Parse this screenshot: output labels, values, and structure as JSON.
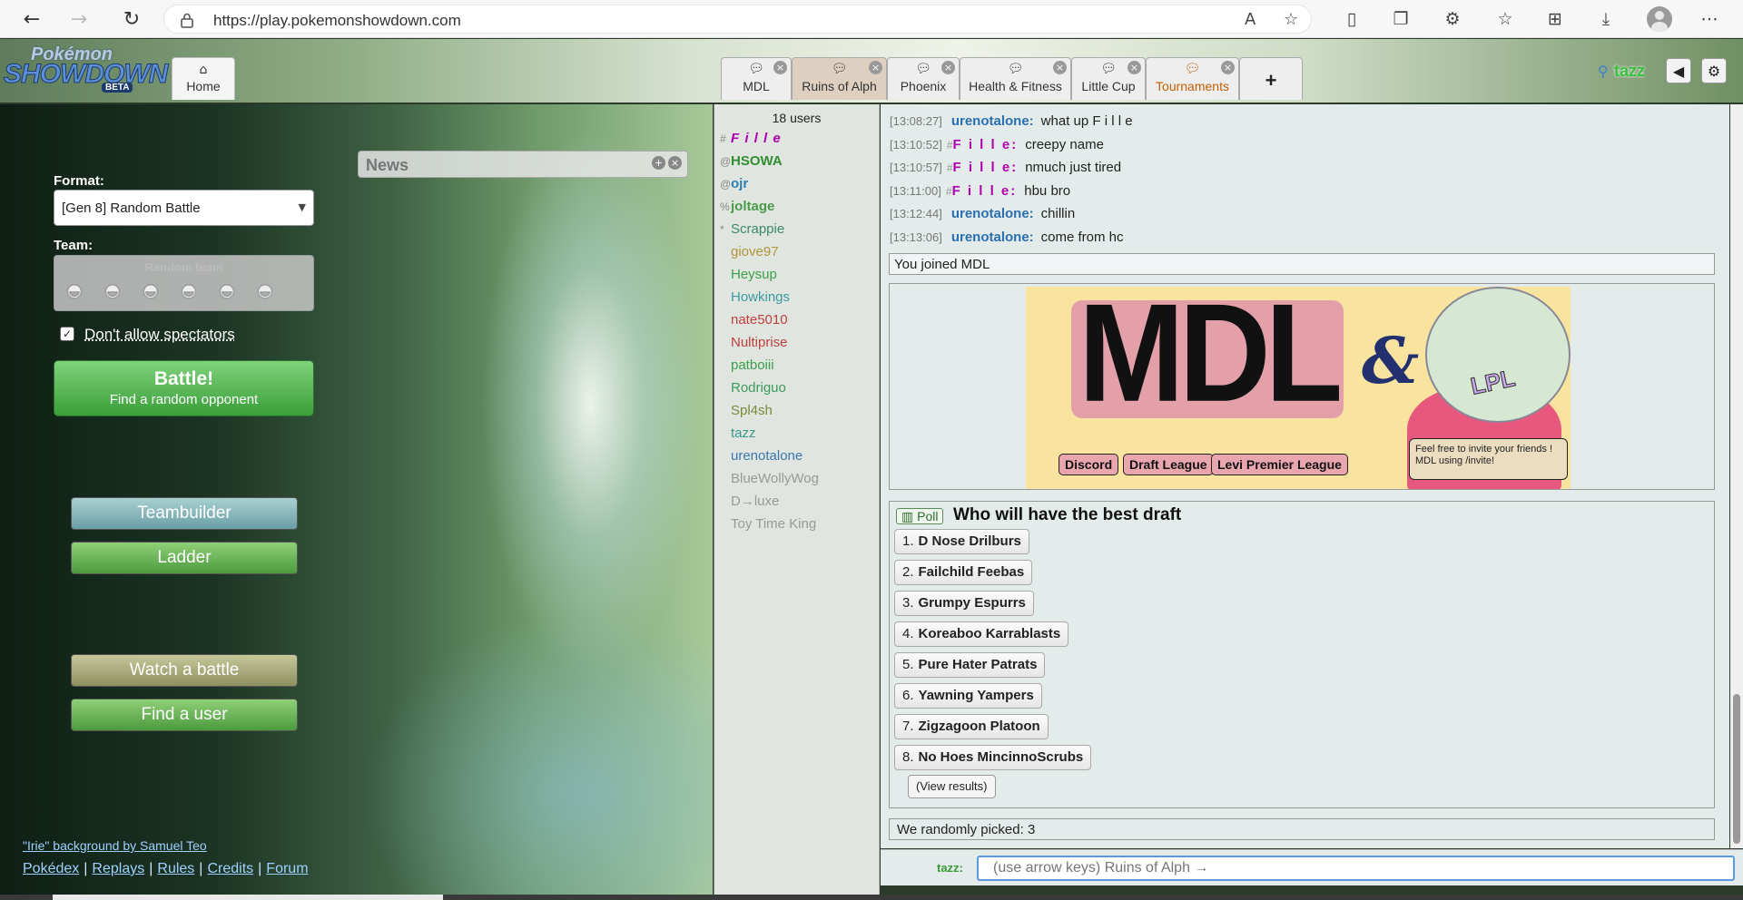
{
  "browser": {
    "url": "https://play.pokemonshowdown.com"
  },
  "header": {
    "logo_line1": "Pokémon",
    "logo_line2": "SHOWDOWN",
    "logo_badge": "BETA",
    "home_label": "Home",
    "tabs": [
      {
        "label": "MDL",
        "active": false
      },
      {
        "label": "Ruins of Alph",
        "active": true
      },
      {
        "label": "Phoenix",
        "active": false
      },
      {
        "label": "Health & Fitness",
        "active": false
      },
      {
        "label": "Little Cup",
        "active": false
      },
      {
        "label": "Tournaments",
        "active": false,
        "highlight": true
      }
    ],
    "add_tab": "+",
    "username": "tazz"
  },
  "left": {
    "news_title": "News",
    "format_label": "Format:",
    "format_value": "[Gen 8] Random Battle",
    "team_label": "Team:",
    "team_value": "Random team",
    "spectators_label": "Don't allow spectators",
    "spectators_checked": true,
    "battle_title": "Battle!",
    "battle_sub": "Find a random opponent",
    "teambuilder": "Teambuilder",
    "ladder": "Ladder",
    "watch": "Watch a battle",
    "find_user": "Find a user",
    "bg_credit": "\"Irie\" background by Samuel Teo",
    "footer": [
      "Pokédex",
      "Replays",
      "Rules",
      "Credits",
      "Forum"
    ]
  },
  "userlist": {
    "count": "18 users",
    "users": [
      {
        "rank": "#",
        "name": "F i l l e",
        "color": "#b000b0",
        "style": "bold-italic"
      },
      {
        "rank": "@",
        "name": "HSOWA",
        "color": "#2f8f2f",
        "style": "bold"
      },
      {
        "rank": "@",
        "name": "ojr",
        "color": "#2a7fb0",
        "style": "bold"
      },
      {
        "rank": "%",
        "name": "joltage",
        "color": "#4a9a4a",
        "style": "bold"
      },
      {
        "rank": "*",
        "name": "Scrappie",
        "color": "#3a8a6a",
        "style": "normal"
      },
      {
        "rank": "",
        "name": "giove97",
        "color": "#b0963a",
        "style": "normal"
      },
      {
        "rank": "",
        "name": "Heysup",
        "color": "#3aa04a",
        "style": "normal"
      },
      {
        "rank": "",
        "name": "Howkings",
        "color": "#3a9aa0",
        "style": "normal"
      },
      {
        "rank": "",
        "name": "nate5010",
        "color": "#c04040",
        "style": "normal"
      },
      {
        "rank": "",
        "name": "Nultiprise",
        "color": "#c04040",
        "style": "normal"
      },
      {
        "rank": "",
        "name": "patboiii",
        "color": "#3aa04a",
        "style": "normal"
      },
      {
        "rank": "",
        "name": "Rodriguo",
        "color": "#3a9a5a",
        "style": "normal"
      },
      {
        "rank": "",
        "name": "Spl4sh",
        "color": "#7a8a3a",
        "style": "normal"
      },
      {
        "rank": "",
        "name": "tazz",
        "color": "#3a9a8a",
        "style": "normal"
      },
      {
        "rank": "",
        "name": "urenotalone",
        "color": "#3a7ab0",
        "style": "normal"
      },
      {
        "rank": "",
        "name": "BlueWollyWog",
        "color": "#999999",
        "style": "idle"
      },
      {
        "rank": "",
        "name": "D→luxe",
        "color": "#999999",
        "style": "idle"
      },
      {
        "rank": "",
        "name": "Toy Time King",
        "color": "#999999",
        "style": "idle"
      }
    ]
  },
  "chat": {
    "messages": [
      {
        "ts": "[13:08:27]",
        "rank": "",
        "author": "urenotalone:",
        "color": "#2a6fb0",
        "text": "what up F i l l e"
      },
      {
        "ts": "[13:10:52]",
        "rank": "#",
        "author": "F i l l e:",
        "color": "#b000b0",
        "text": "creepy name"
      },
      {
        "ts": "[13:10:57]",
        "rank": "#",
        "author": "F i l l e:",
        "color": "#b000b0",
        "text": "nmuch just tired"
      },
      {
        "ts": "[13:11:00]",
        "rank": "#",
        "author": "F i l l e:",
        "color": "#b000b0",
        "text": "hbu bro"
      },
      {
        "ts": "[13:12:44]",
        "rank": "",
        "author": "urenotalone:",
        "color": "#2a6fb0",
        "text": "chillin"
      },
      {
        "ts": "[13:13:06]",
        "rank": "",
        "author": "urenotalone:",
        "color": "#2a6fb0",
        "text": "come from hc"
      }
    ],
    "joined": "You joined MDL",
    "banner": {
      "title": "MDL",
      "amp": "&",
      "badge": "LPL",
      "buttons": [
        "Discord",
        "Draft League",
        "Levi Premier League"
      ],
      "note": "Feel free to invite your friends ! MDL using /invite!"
    },
    "poll": {
      "badge": "Poll",
      "question": "Who will have the best draft",
      "options": [
        {
          "num": "1.",
          "label": "D Nose Drilburs"
        },
        {
          "num": "2.",
          "label": "Failchild Feebas"
        },
        {
          "num": "3.",
          "label": "Grumpy Espurrs"
        },
        {
          "num": "4.",
          "label": "Koreaboo Karrablasts"
        },
        {
          "num": "5.",
          "label": "Pure Hater Patrats"
        },
        {
          "num": "6.",
          "label": "Yawning Yampers"
        },
        {
          "num": "7.",
          "label": "Zigzagoon Platoon"
        },
        {
          "num": "8.",
          "label": "No Hoes MincinnoScrubs"
        }
      ],
      "view_results": "(View results)"
    },
    "picked": "We randomly picked:  3",
    "input_user": "tazz:",
    "input_placeholder": "(use arrow keys) Ruins of Alph →"
  }
}
